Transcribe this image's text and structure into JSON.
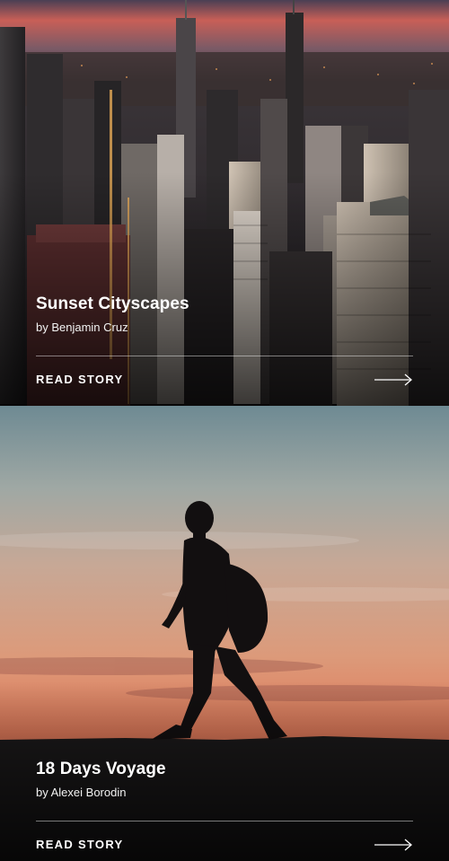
{
  "stories": [
    {
      "title": "Sunset Cityscapes",
      "author": "by Benjamin Cruz",
      "cta_label": "READ STORY",
      "cta_icon": "arrow-right-icon",
      "image": "city-skyline-aerial-dusk"
    },
    {
      "title": "18 Days Voyage",
      "author": "by Alexei Borodin",
      "cta_label": "READ STORY",
      "cta_icon": "arrow-right-icon",
      "image": "hiker-silhouette-sunset"
    }
  ],
  "colors": {
    "text": "#ffffff",
    "divider": "#ffffff73",
    "sky_top": "#6a7f8c",
    "sky_sunset": "#e8845c"
  }
}
